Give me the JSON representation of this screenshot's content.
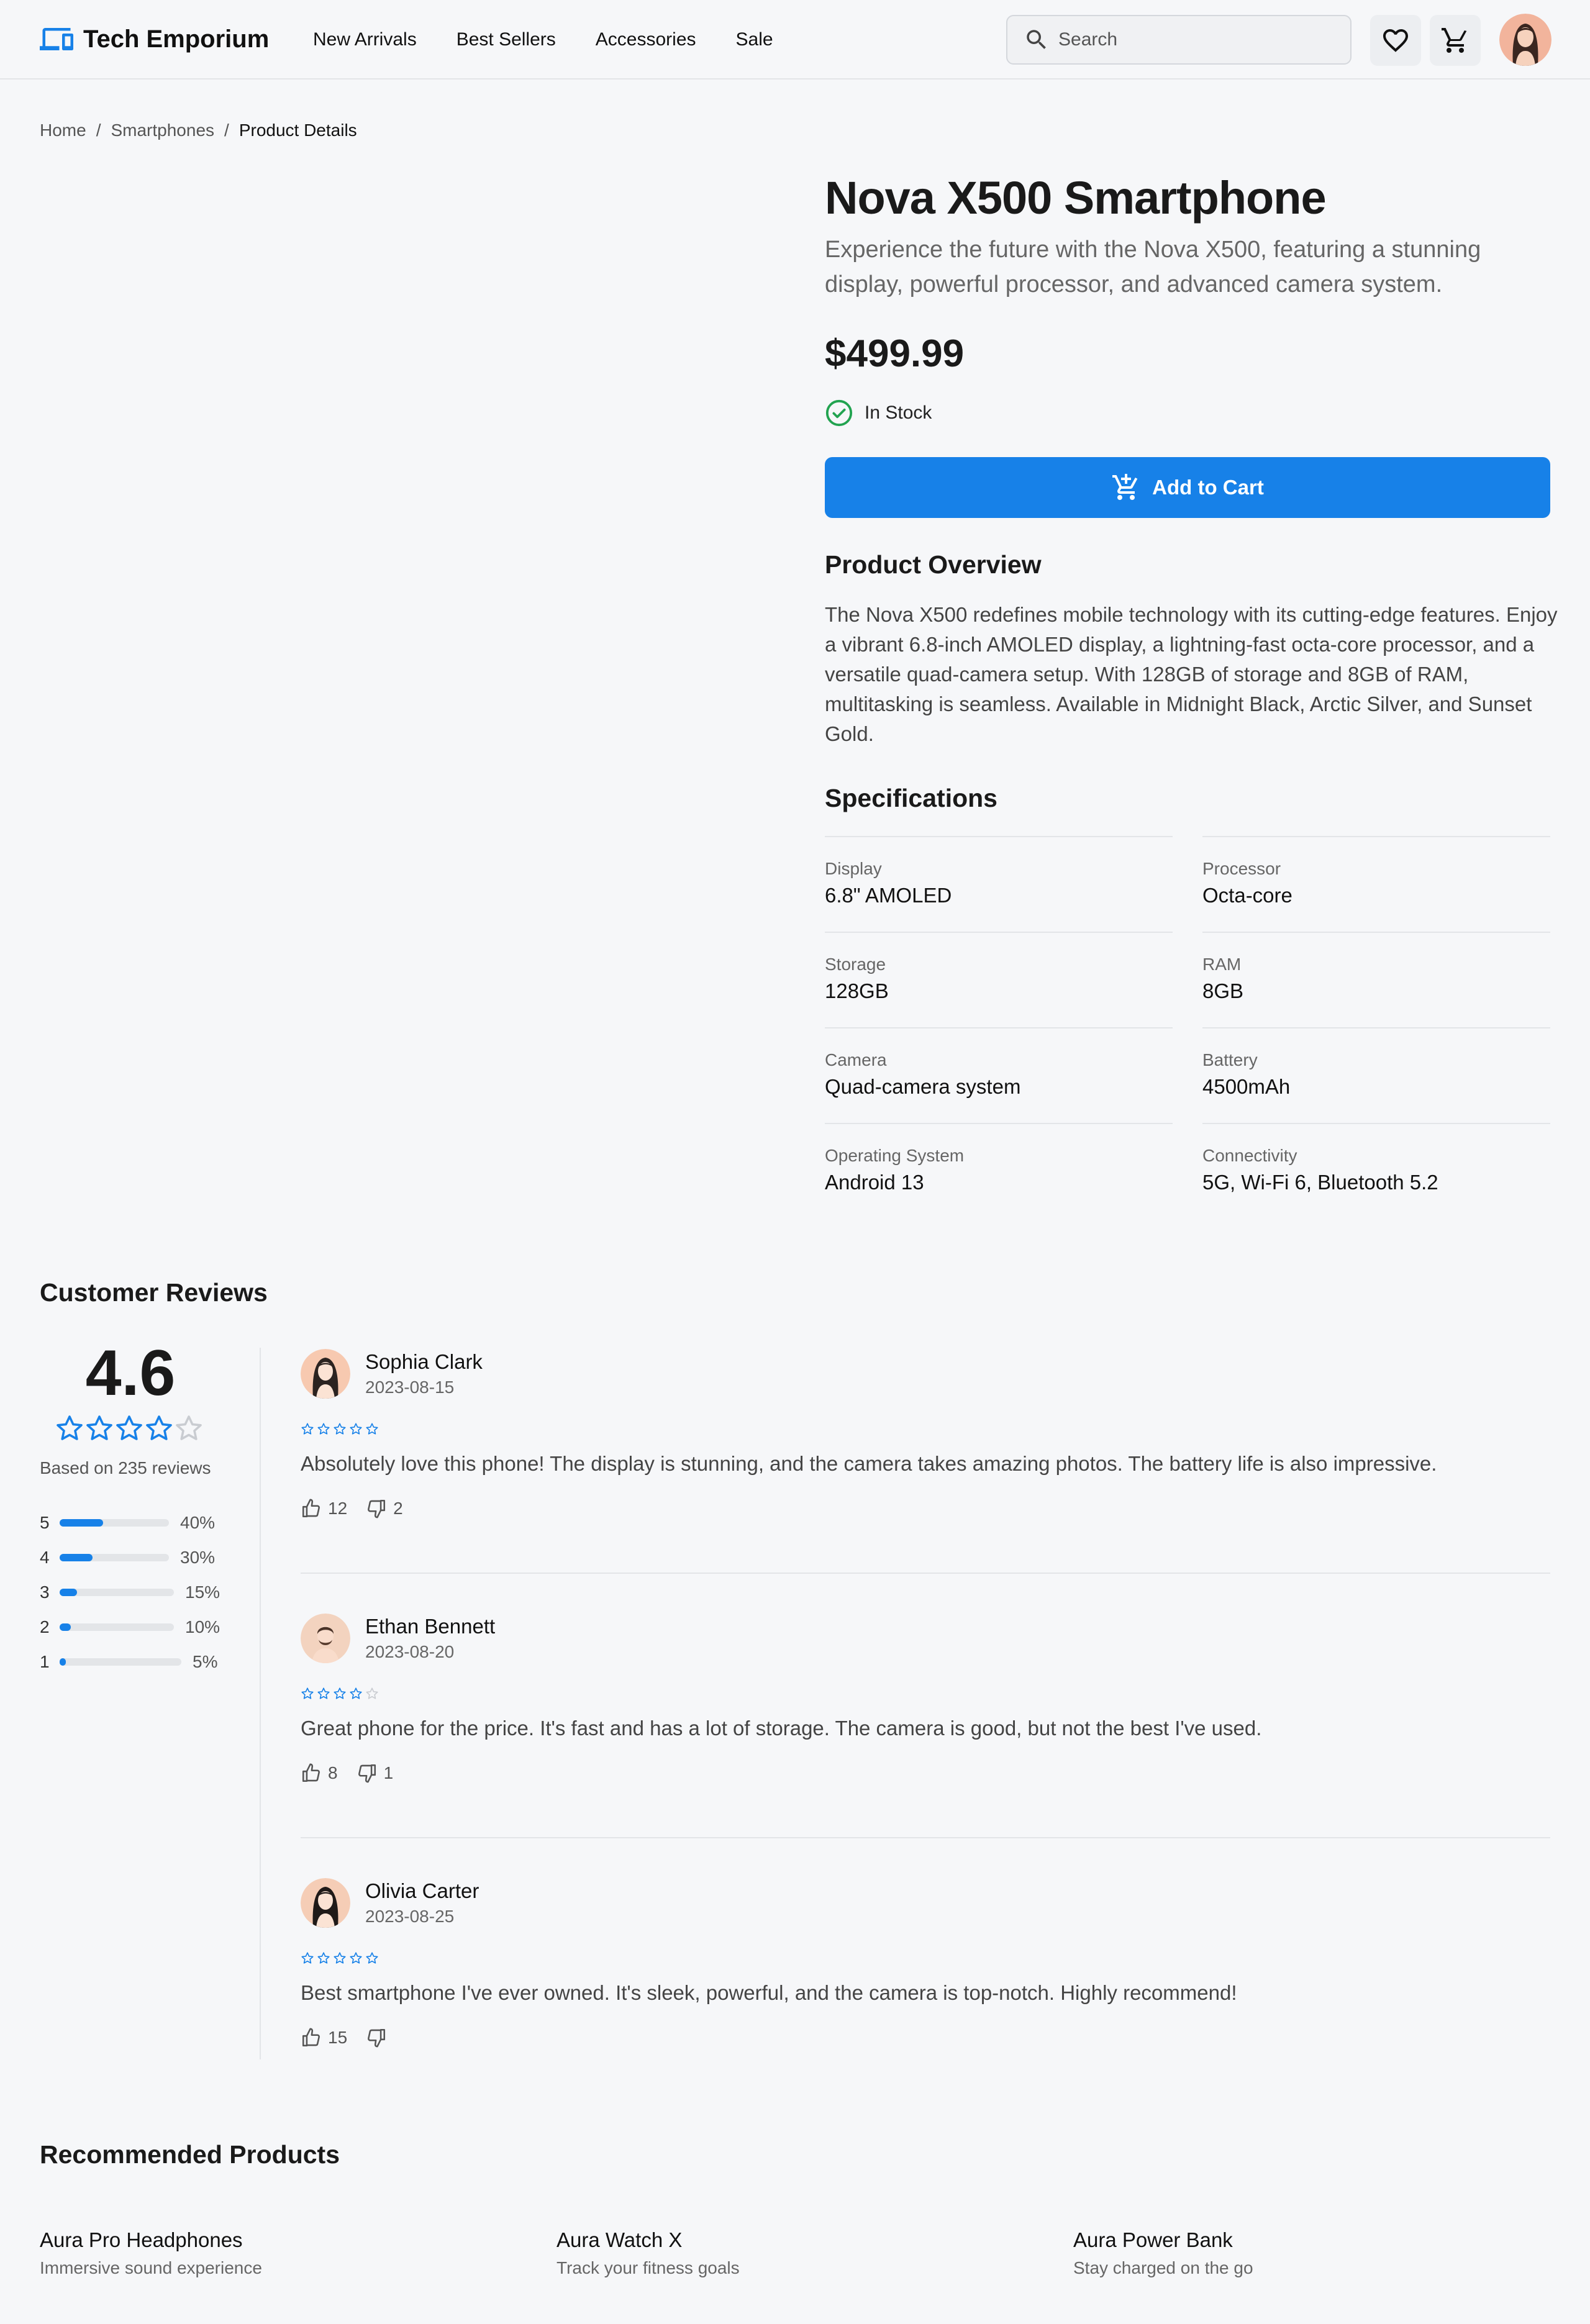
{
  "brand": {
    "name": "Tech Emporium",
    "accent": "#1781e8"
  },
  "nav": [
    "New Arrivals",
    "Best Sellers",
    "Accessories",
    "Sale"
  ],
  "search": {
    "placeholder": "Search"
  },
  "breadcrumb": {
    "home": "Home",
    "category": "Smartphones",
    "current": "Product Details",
    "separator": "/"
  },
  "product": {
    "title": "Nova X500 Smartphone",
    "subtitle": "Experience the future with the Nova X500, featuring a stunning display, powerful processor, and advanced camera system.",
    "price": "$499.99",
    "stock": "In Stock",
    "cart_label": "Add to Cart",
    "overview_heading": "Product Overview",
    "overview": "The Nova X500 redefines mobile technology with its cutting-edge features. Enjoy a vibrant 6.8-inch AMOLED display, a lightning-fast octa-core processor, and a versatile quad-camera setup. With 128GB of storage and 8GB of RAM, multitasking is seamless. Available in Midnight Black, Arctic Silver, and Sunset Gold.",
    "specs_heading": "Specifications",
    "specs": [
      {
        "label": "Display",
        "value": "6.8\" AMOLED"
      },
      {
        "label": "Processor",
        "value": "Octa-core"
      },
      {
        "label": "Storage",
        "value": "128GB"
      },
      {
        "label": "RAM",
        "value": "8GB"
      },
      {
        "label": "Camera",
        "value": "Quad-camera system"
      },
      {
        "label": "Battery",
        "value": "4500mAh"
      },
      {
        "label": "Operating System",
        "value": "Android 13"
      },
      {
        "label": "Connectivity",
        "value": "5G, Wi-Fi 6, Bluetooth 5.2"
      }
    ]
  },
  "reviews": {
    "heading": "Customer Reviews",
    "average": "4.6",
    "average_stars": 4,
    "based_on": "Based on 235 reviews",
    "distribution": [
      {
        "stars": "5",
        "pct": "40%",
        "value": 40
      },
      {
        "stars": "4",
        "pct": "30%",
        "value": 30
      },
      {
        "stars": "3",
        "pct": "15%",
        "value": 15
      },
      {
        "stars": "2",
        "pct": "10%",
        "value": 10
      },
      {
        "stars": "1",
        "pct": "5%",
        "value": 5
      }
    ],
    "items": [
      {
        "name": "Sophia Clark",
        "date": "2023-08-15",
        "stars": 5,
        "text": "Absolutely love this phone! The display is stunning, and the camera takes amazing photos. The battery life is also impressive.",
        "likes": "12",
        "dislikes": "2"
      },
      {
        "name": "Ethan Bennett",
        "date": "2023-08-20",
        "stars": 4,
        "text": "Great phone for the price. It's fast and has a lot of storage. The camera is good, but not the best I've used.",
        "likes": "8",
        "dislikes": "1"
      },
      {
        "name": "Olivia Carter",
        "date": "2023-08-25",
        "stars": 5,
        "text": "Best smartphone I've ever owned. It's sleek, powerful, and the camera is top-notch. Highly recommend!",
        "likes": "15",
        "dislikes": ""
      }
    ]
  },
  "recommended": {
    "heading": "Recommended Products",
    "items": [
      {
        "title": "Aura Pro Headphones",
        "subtitle": "Immersive sound experience"
      },
      {
        "title": "Aura Watch X",
        "subtitle": "Track your fitness goals"
      },
      {
        "title": "Aura Power Bank",
        "subtitle": "Stay charged on the go"
      }
    ]
  }
}
